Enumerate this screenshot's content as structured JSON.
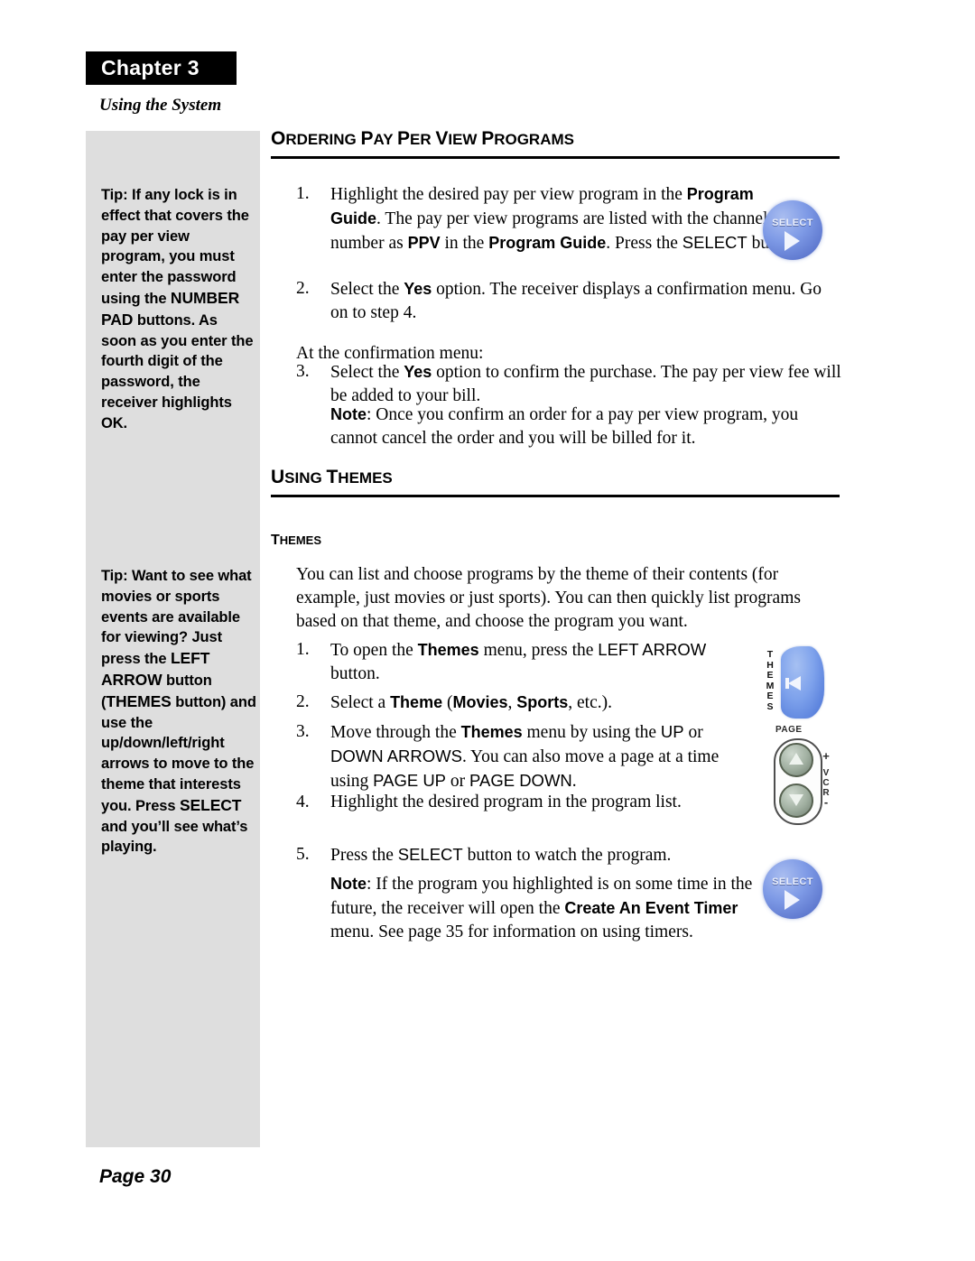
{
  "chapter": {
    "banner_label": "Chapter 3",
    "subtitle": "Using the System"
  },
  "sidebar": {
    "tips": [
      {
        "name": "tip-pay-per-view-lock",
        "segments": [
          {
            "text": "Tip: If any lock is in effect that covers the pay per view program, you must enter the password using the ",
            "caps": false
          },
          {
            "text": "NUMBER PAD",
            "caps": true
          },
          {
            "text": " buttons. As soon as you enter the fourth digit of the password, the receiver highlights OK.",
            "caps": false
          }
        ]
      },
      {
        "name": "tip-themes-button",
        "segments": [
          {
            "text": "Tip: Want to see what movies or sports events are available for viewing? Just press the ",
            "caps": false
          },
          {
            "text": "LEFT ARROW",
            "caps": true
          },
          {
            "text": " button (",
            "caps": false
          },
          {
            "text": "THEMES",
            "caps": true
          },
          {
            "text": " button) and use the up/down/left/right arrows to move to the theme that interests you. Press ",
            "caps": false
          },
          {
            "text": "SELECT",
            "caps": true
          },
          {
            "text": " and you’ll see what’s playing.",
            "caps": false
          }
        ]
      }
    ]
  },
  "sections": {
    "ordering_ppv": {
      "heading_first": "O",
      "heading_rest": "RDERING ",
      "heading_words": [
        "O",
        "RDERING ",
        "P",
        "AY ",
        "P",
        "ER ",
        "V",
        "IEW ",
        "P",
        "ROGRAMS"
      ],
      "steps": [
        {
          "number": "1.",
          "runs": [
            {
              "t": "Highlight the desired pay per view program in the ",
              "s": "n"
            },
            {
              "t": "Program Guide",
              "s": "b"
            },
            {
              "t": ". The pay per view programs are listed with the channel number as ",
              "s": "n"
            },
            {
              "t": "PPV",
              "s": "b"
            },
            {
              "t": " in the ",
              "s": "n"
            },
            {
              "t": "Program Guide",
              "s": "b"
            },
            {
              "t": ". Press the ",
              "s": "n"
            },
            {
              "t": "SELECT",
              "s": "c"
            },
            {
              "t": " button.",
              "s": "n"
            }
          ]
        },
        {
          "number": "2.",
          "runs": [
            {
              "t": "Select the ",
              "s": "n"
            },
            {
              "t": "Yes",
              "s": "b"
            },
            {
              "t": " option. The receiver displays a confirmation menu. Go on to step 4.",
              "s": "n"
            }
          ]
        }
      ],
      "interlude": "At the confirmation menu:",
      "steps2": [
        {
          "number": "3.",
          "runs": [
            {
              "t": "Select the ",
              "s": "n"
            },
            {
              "t": "Yes",
              "s": "b"
            },
            {
              "t": " option to confirm the purchase. The pay per view fee will be added to your bill.",
              "s": "n"
            }
          ]
        }
      ],
      "note": {
        "runs": [
          {
            "t": "Note",
            "s": "b"
          },
          {
            "t": ": Once you confirm an order for a pay per view program, you cannot cancel the order and you will be billed for it.",
            "s": "n"
          }
        ]
      }
    },
    "using_themes": {
      "heading_words": [
        "U",
        "SING ",
        "T",
        "HEMES"
      ],
      "subheading_words": [
        "T",
        "HEMES"
      ],
      "intro": "You can list and choose programs by the theme of their contents (for example, just movies or just sports). You can then quickly list programs based on that theme, and choose the program you want.",
      "steps": [
        {
          "number": "1.",
          "runs": [
            {
              "t": "To open the ",
              "s": "n"
            },
            {
              "t": "Themes",
              "s": "b"
            },
            {
              "t": " menu, press the ",
              "s": "n"
            },
            {
              "t": "LEFT ARROW",
              "s": "c"
            },
            {
              "t": " button.",
              "s": "n"
            }
          ]
        },
        {
          "number": "2.",
          "runs": [
            {
              "t": "Select a ",
              "s": "n"
            },
            {
              "t": "Theme",
              "s": "b"
            },
            {
              "t": " (",
              "s": "n"
            },
            {
              "t": "Movies",
              "s": "b"
            },
            {
              "t": ", ",
              "s": "n"
            },
            {
              "t": "Sports",
              "s": "b"
            },
            {
              "t": ", etc.).",
              "s": "n"
            }
          ]
        },
        {
          "number": "3.",
          "runs": [
            {
              "t": "Move through the ",
              "s": "n"
            },
            {
              "t": "Themes",
              "s": "b"
            },
            {
              "t": " menu by using the ",
              "s": "n"
            },
            {
              "t": "UP",
              "s": "c"
            },
            {
              "t": " or ",
              "s": "n"
            },
            {
              "t": "DOWN ARROWS",
              "s": "c"
            },
            {
              "t": ". You can also move a page at a time using ",
              "s": "n"
            },
            {
              "t": "PAGE UP",
              "s": "c"
            },
            {
              "t": " or ",
              "s": "n"
            },
            {
              "t": "PAGE DOWN",
              "s": "c"
            },
            {
              "t": ".",
              "s": "n"
            }
          ]
        },
        {
          "number": "4.",
          "runs": [
            {
              "t": "Highlight the desired program in the program list.",
              "s": "n"
            }
          ]
        },
        {
          "number": "5.",
          "runs": [
            {
              "t": "Press the ",
              "s": "n"
            },
            {
              "t": "SELECT",
              "s": "c"
            },
            {
              "t": " button to watch the program.",
              "s": "n"
            }
          ]
        }
      ],
      "note": {
        "runs": [
          {
            "t": "Note",
            "s": "b"
          },
          {
            "t": ": If the program you highlighted is on some time in the future, the receiver will open the ",
            "s": "n"
          },
          {
            "t": "Create An Event Timer",
            "s": "b"
          },
          {
            "t": " menu. See page 35 for information on using timers.",
            "s": "n"
          }
        ]
      }
    }
  },
  "graphics": {
    "select_button": {
      "label": "SELECT",
      "color": "#7e9ae6"
    },
    "themes_button": {
      "label": "THEMES",
      "color": "#7ea2ec"
    },
    "page_button": {
      "label": "PAGE",
      "vcr_label": "VCR",
      "plus": "+",
      "minus": "-"
    }
  },
  "footer": {
    "page_label": "Page 30"
  }
}
